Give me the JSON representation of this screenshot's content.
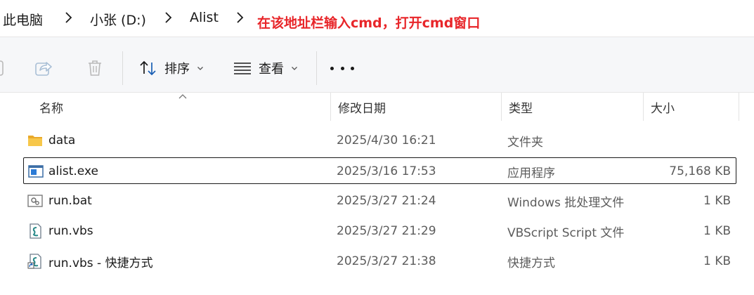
{
  "breadcrumb": {
    "items": [
      "此电脑",
      "小张 (D:)",
      "Alist"
    ]
  },
  "annotation": "在该地址栏输入cmd，打开cmd窗口",
  "toolbar": {
    "sort_label": "排序",
    "view_label": "查看"
  },
  "columns": {
    "name": "名称",
    "modified": "修改日期",
    "type": "类型",
    "size": "大小"
  },
  "files": [
    {
      "name": "data",
      "modified": "2025/4/30 16:21",
      "type": "文件夹",
      "size": "",
      "icon": "folder-icon"
    },
    {
      "name": "alist.exe",
      "modified": "2025/3/16 17:53",
      "type": "应用程序",
      "size": "75,168 KB",
      "icon": "exe-icon",
      "selected": true
    },
    {
      "name": "run.bat",
      "modified": "2025/3/27 21:24",
      "type": "Windows 批处理文件",
      "size": "1 KB",
      "icon": "bat-icon"
    },
    {
      "name": "run.vbs",
      "modified": "2025/3/27 21:29",
      "type": "VBScript Script 文件",
      "size": "1 KB",
      "icon": "vbs-icon"
    },
    {
      "name": "run.vbs - 快捷方式",
      "modified": "2025/3/27 21:38",
      "type": "快捷方式",
      "size": "1 KB",
      "icon": "shortcut-icon"
    }
  ],
  "colors": {
    "annotation": "#e8262a",
    "folder": "#f7c74a",
    "toolbar_bg": "#f6f7f9"
  }
}
